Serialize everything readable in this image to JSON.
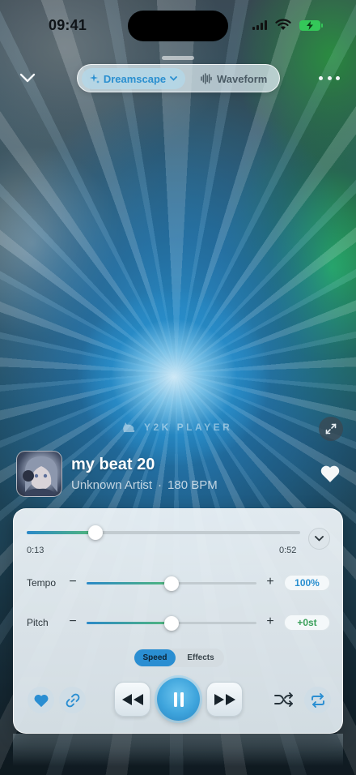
{
  "status_bar": {
    "time": "09:41"
  },
  "nav": {
    "segments": [
      {
        "label": "Dreamscape",
        "icon": "sparkle-icon",
        "selected": true
      },
      {
        "label": "Waveform",
        "icon": "waveform-icon",
        "selected": false
      }
    ]
  },
  "visualizer": {
    "watermark": "Y2K PLAYER"
  },
  "track": {
    "title": "my beat 20",
    "artist": "Unknown Artist",
    "separator": "·",
    "bpm": "180 BPM"
  },
  "player": {
    "current_time": "0:13",
    "total_time": "0:52",
    "progress": 0.25,
    "tempo": {
      "label": "Tempo",
      "value": "100%",
      "level": 0.5
    },
    "pitch": {
      "label": "Pitch",
      "value": "+0st",
      "level": 0.5
    },
    "modes": [
      {
        "label": "Speed",
        "selected": true
      },
      {
        "label": "Effects",
        "selected": false
      }
    ],
    "minus": "−",
    "plus": "+"
  },
  "colors": {
    "accent": "#2a8ed2",
    "green": "#52b87a",
    "pitch_value": "#3aa05a",
    "tempo_value": "#2a8fd0"
  }
}
